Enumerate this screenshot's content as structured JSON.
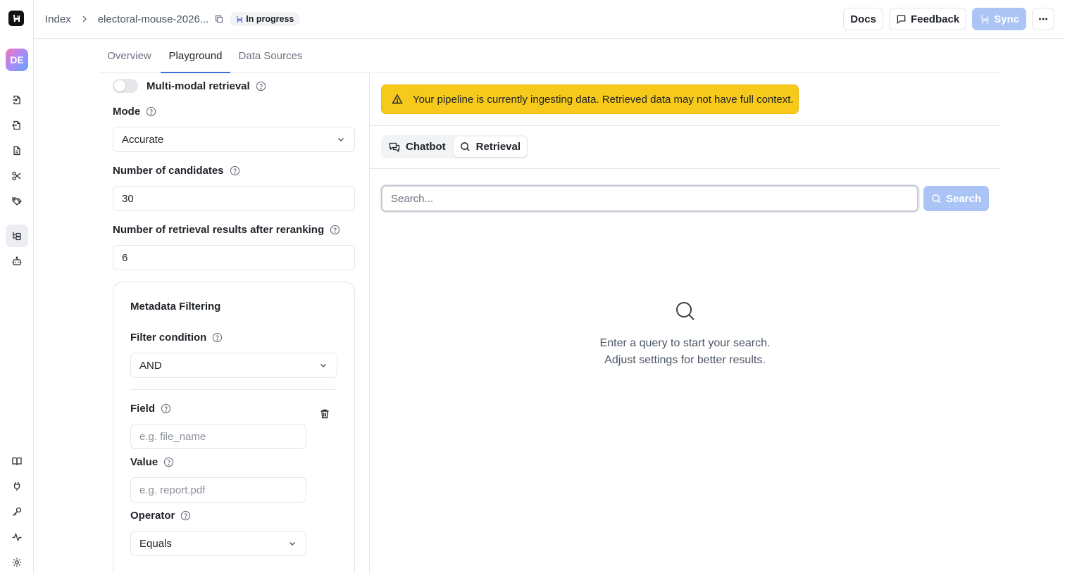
{
  "breadcrumb": {
    "root": "Index",
    "pipeline": "electoral-mouse-2026...",
    "status": "In progress"
  },
  "topbar": {
    "docs": "Docs",
    "feedback": "Feedback",
    "sync": "Sync"
  },
  "user": {
    "initials": "DE"
  },
  "tabs": [
    "Overview",
    "Playground",
    "Data Sources"
  ],
  "active_tab": "Playground",
  "settings": {
    "multimodal_label": "Multi-modal retrieval",
    "multimodal_enabled": false,
    "mode_label": "Mode",
    "mode_value": "Accurate",
    "candidates_label": "Number of candidates",
    "candidates_value": "30",
    "rerank_label": "Number of retrieval results after reranking",
    "rerank_value": "6"
  },
  "metadata": {
    "title": "Metadata Filtering",
    "condition_label": "Filter condition",
    "condition_value": "AND",
    "field_label": "Field",
    "field_placeholder": "e.g. file_name",
    "value_label": "Value",
    "value_placeholder": "e.g. report.pdf",
    "operator_label": "Operator",
    "operator_value": "Equals"
  },
  "alert": {
    "message": "Your pipeline is currently ingesting data. Retrieved data may not have full context.",
    "color": "#f6c91b"
  },
  "mode_switch": {
    "chatbot": "Chatbot",
    "retrieval": "Retrieval",
    "active": "Retrieval"
  },
  "search": {
    "placeholder": "Search...",
    "button": "Search"
  },
  "empty_state": {
    "line1": "Enter a query to start your search.",
    "line2": "Adjust settings for better results."
  },
  "colors": {
    "accent": "#3b6fd8",
    "disabled_button": "#a9c4f5"
  }
}
